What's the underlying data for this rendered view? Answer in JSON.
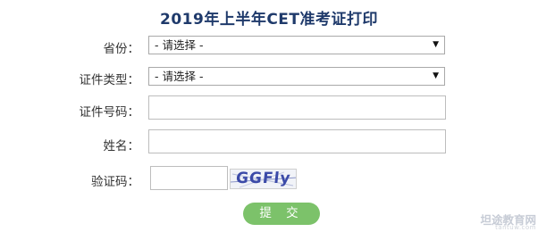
{
  "page": {
    "title": "2019年上半年CET准考证打印"
  },
  "form": {
    "province": {
      "label": "省份：",
      "value": "- 请选择 -"
    },
    "id_type": {
      "label": "证件类型：",
      "value": "- 请选择 -"
    },
    "id_number": {
      "label": "证件号码：",
      "value": "",
      "placeholder": ""
    },
    "name": {
      "label": "姓名：",
      "value": "",
      "placeholder": ""
    },
    "captcha": {
      "label": "验证码：",
      "value": "",
      "image_text": "GGFly"
    },
    "submit_label": "提 交"
  },
  "watermark": {
    "text": "坦途教育网",
    "sub": "tantuw.com"
  },
  "colors": {
    "title": "#1f3a6b",
    "submit_bg": "#7cc26a",
    "captcha_text": "#3b4aa8"
  },
  "icons": {
    "select_arrow": "chevron-down-icon"
  }
}
